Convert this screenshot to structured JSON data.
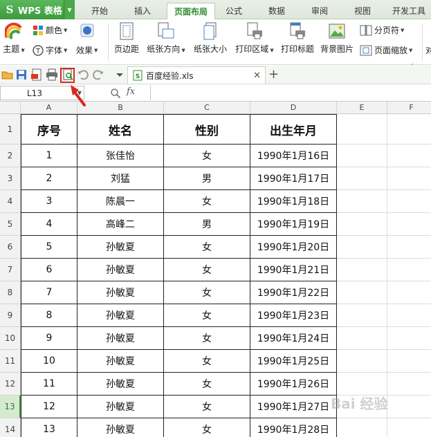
{
  "app": {
    "name": "WPS 表格",
    "logo": "S"
  },
  "tabs": [
    "开始",
    "插入",
    "页面布局",
    "公式",
    "数据",
    "审阅",
    "视图",
    "开发工具"
  ],
  "active_tab": "页面布局",
  "ribbon": {
    "theme": "主题",
    "colors": "颜色",
    "fonts": "字体",
    "effects": "效果",
    "margins": "页边距",
    "orientation": "纸张方向",
    "size": "纸张大小",
    "print_area": "打印区域",
    "print_titles": "打印标题",
    "background": "背景图片",
    "page_break": "分页符",
    "page_zoom": "页面缩放",
    "cut_label": "对"
  },
  "document": {
    "tab_name": "百度经验.xls"
  },
  "formula_bar": {
    "cell_ref": "L13",
    "fx": "fx"
  },
  "columns": [
    "A",
    "B",
    "C",
    "D",
    "E",
    "F"
  ],
  "table": {
    "headers": [
      "序号",
      "姓名",
      "性别",
      "出生年月"
    ],
    "rows": [
      [
        "1",
        "张佳怡",
        "女",
        "1990年1月16日"
      ],
      [
        "2",
        "刘猛",
        "男",
        "1990年1月17日"
      ],
      [
        "3",
        "陈晨一",
        "女",
        "1990年1月18日"
      ],
      [
        "4",
        "高峰二",
        "男",
        "1990年1月19日"
      ],
      [
        "5",
        "孙敏夏",
        "女",
        "1990年1月20日"
      ],
      [
        "6",
        "孙敏夏",
        "女",
        "1990年1月21日"
      ],
      [
        "7",
        "孙敏夏",
        "女",
        "1990年1月22日"
      ],
      [
        "8",
        "孙敏夏",
        "女",
        "1990年1月23日"
      ],
      [
        "9",
        "孙敏夏",
        "女",
        "1990年1月24日"
      ],
      [
        "10",
        "孙敏夏",
        "女",
        "1990年1月25日"
      ],
      [
        "11",
        "孙敏夏",
        "女",
        "1990年1月26日"
      ],
      [
        "12",
        "孙敏夏",
        "女",
        "1990年1月27日"
      ],
      [
        "13",
        "孙敏夏",
        "女",
        "1990年1月28日"
      ]
    ]
  },
  "row_numbers": [
    "1",
    "2",
    "3",
    "4",
    "5",
    "6",
    "7",
    "8",
    "9",
    "10",
    "11",
    "12",
    "13",
    "14"
  ],
  "selected_row": "13",
  "watermark": "Bai 经验",
  "colors": {
    "accent": "#3d9a3d",
    "highlight": "#d9281f"
  }
}
